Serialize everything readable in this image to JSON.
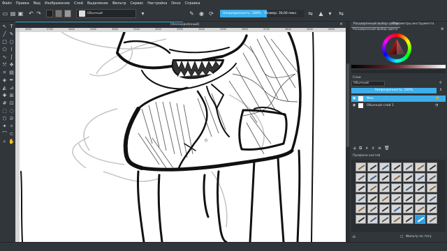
{
  "menu": [
    "Файл",
    "Правка",
    "Вид",
    "Изображение",
    "Слой",
    "Выделение",
    "Фильтр",
    "Сервис",
    "Настройка",
    "Окно",
    "Справка"
  ],
  "toolbar": {
    "brush_preset": "Обычный",
    "opacity": "Непрозрачность: 100%",
    "opacity_fraction": 1.0,
    "size": "Размер: 30,00 пикс.",
    "size_fraction": 0.12
  },
  "document": {
    "tab_title": "[Несохранённый]"
  },
  "ruler": {
    "ticks": [
      "2600",
      "2700",
      "2800",
      "2900",
      "3000",
      "3100",
      "3200",
      "3300",
      "3400",
      "3500",
      "3600",
      "3700",
      "3800",
      "3900",
      "4000"
    ]
  },
  "dock": {
    "color_tabs": [
      "Расширенный выбор цвета",
      "Параметры инструмента"
    ],
    "color_panel_title": "Расширенный выбор цвета",
    "layers_title": "Слои",
    "blend_mode": "Обычный",
    "layer_opacity": "Непрозрачность: 100%",
    "layers": [
      {
        "name": "Фон",
        "selected": true
      },
      {
        "name": "Обычный слой 1",
        "selected": false
      }
    ],
    "brush_presets_title": "Профили кистей",
    "brush_filter": "Фильтр по тегу"
  },
  "colors": {
    "accent": "#3daee9",
    "panel": "#31363b",
    "canvas": "#ffffff"
  },
  "icons": [
    "pointer-icon",
    "text-icon",
    "line-icon",
    "brush-icon",
    "rectangle-icon",
    "ellipse-icon",
    "transform-icon",
    "move-icon",
    "fill-icon",
    "gradient-icon",
    "eyedropper-icon",
    "zoom-icon",
    "pan-icon",
    "select-rect-icon",
    "select-ellipse-icon",
    "select-freehand-icon"
  ]
}
